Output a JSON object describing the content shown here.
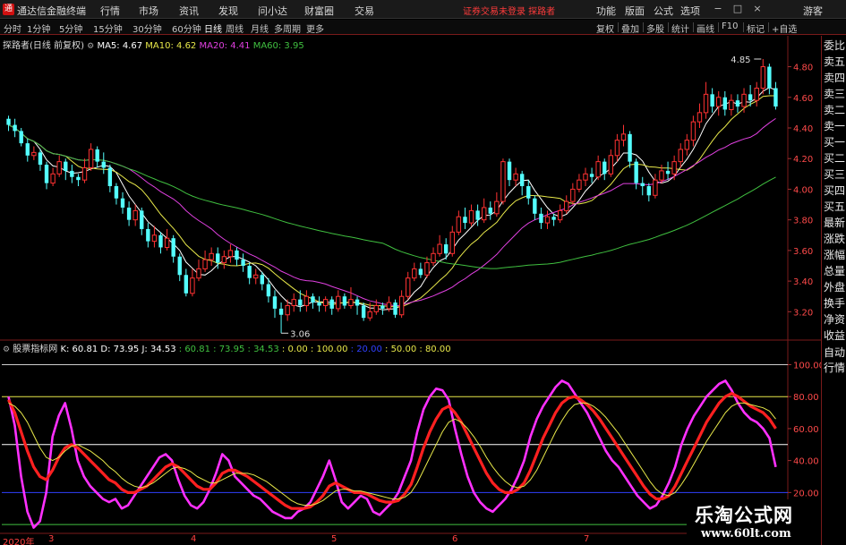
{
  "app": {
    "title": "通达信金融终端",
    "menu": [
      "行情",
      "市场",
      "资讯",
      "发现",
      "问小达",
      "财富圈",
      "交易"
    ],
    "login_status": "证券交易未登录  探路者",
    "right_menu": [
      "功能",
      "版面",
      "公式",
      "选项"
    ],
    "guest_label": "游客",
    "window_controls": {
      "min": "−",
      "max": "□",
      "close": "×"
    }
  },
  "toolbar": {
    "periods": [
      "分时",
      "1分钟",
      "5分钟",
      "15分钟",
      "30分钟",
      "60分钟",
      "日线",
      "周线",
      "月线",
      "多周期",
      "更多"
    ],
    "active_period": "日线",
    "tools": [
      "复权",
      "叠加",
      "多股",
      "统计",
      "画线",
      "F10",
      "标记",
      "+自选"
    ]
  },
  "main_info": {
    "stock": "探路者(日线 前复权)",
    "ma5": "MA5: 4.67",
    "ma10": "MA10: 4.62",
    "ma20": "MA20: 4.41",
    "ma60": "MA60: 3.95",
    "colors": {
      "stock": "#dcdcdc",
      "ma5": "#ffffff",
      "ma10": "#e8e84a",
      "ma20": "#e040e0",
      "ma60": "#40c040"
    }
  },
  "kdj_info": {
    "name": "股票指标网",
    "k": "K: 60.81",
    "d": "D: 73.95",
    "j": "J: 34.53",
    "extra": [
      ": 60.81",
      ": 73.95",
      ": 34.53",
      ": 0.00",
      ": 100.00",
      ": 20.00",
      ": 50.00",
      ": 80.00"
    ]
  },
  "sidebar": {
    "items": [
      "委比",
      "卖五",
      "卖四",
      "卖三",
      "卖二",
      "卖一",
      "买一",
      "买二",
      "买三",
      "买四",
      "买五",
      "最新",
      "涨跌",
      "涨幅",
      "总量",
      "外盘",
      "换手",
      "净资",
      "收益"
    ],
    "lower": [
      "自动",
      "行情"
    ]
  },
  "watermark": {
    "title": "乐淘公式网",
    "url": "www.60lt.com"
  },
  "bottom_axis": {
    "year_label": "2020年",
    "months": [
      "3",
      "4",
      "5",
      "6",
      "7"
    ]
  },
  "chart_data": [
    {
      "type": "candlestick",
      "y_ticks": [
        "4.80",
        "4.60",
        "4.40",
        "4.20",
        "4.00",
        "3.80",
        "3.60",
        "3.40",
        "3.20"
      ],
      "y_values": [
        4.8,
        4.6,
        4.4,
        4.2,
        4.0,
        3.8,
        3.6,
        3.4,
        3.2
      ],
      "ylim": [
        3.05,
        4.92
      ],
      "high_label": "4.85",
      "high_value": 4.85,
      "low_label": "3.06",
      "low_value": 3.06,
      "colors": {
        "up": "#ff3232",
        "down": "#54ffff",
        "ma5": "#ffffff",
        "ma10": "#e8e84a",
        "ma20": "#e040e0",
        "ma60": "#40c040"
      },
      "candles": [
        [
          4.46,
          4.42,
          4.48,
          4.38
        ],
        [
          4.42,
          4.38,
          4.46,
          4.34
        ],
        [
          4.38,
          4.3,
          4.4,
          4.28
        ],
        [
          4.3,
          4.22,
          4.33,
          4.18
        ],
        [
          4.22,
          4.24,
          4.28,
          4.19
        ],
        [
          4.24,
          4.16,
          4.26,
          4.12
        ],
        [
          4.16,
          4.04,
          4.18,
          4.0
        ],
        [
          4.04,
          4.1,
          4.14,
          4.02
        ],
        [
          4.1,
          4.18,
          4.22,
          4.08
        ],
        [
          4.18,
          4.12,
          4.2,
          4.06
        ],
        [
          4.12,
          4.08,
          4.16,
          4.04
        ],
        [
          4.08,
          4.06,
          4.1,
          4.02
        ],
        [
          4.06,
          4.14,
          4.2,
          4.04
        ],
        [
          4.14,
          4.26,
          4.3,
          4.12
        ],
        [
          4.26,
          4.18,
          4.28,
          4.14
        ],
        [
          4.18,
          4.14,
          4.24,
          4.1
        ],
        [
          4.14,
          4.02,
          4.16,
          3.98
        ],
        [
          4.02,
          3.94,
          4.04,
          3.9
        ],
        [
          3.94,
          3.88,
          3.98,
          3.84
        ],
        [
          3.88,
          3.8,
          3.92,
          3.76
        ],
        [
          3.8,
          3.86,
          3.9,
          3.76
        ],
        [
          3.86,
          3.74,
          3.88,
          3.7
        ],
        [
          3.74,
          3.66,
          3.78,
          3.62
        ],
        [
          3.66,
          3.7,
          3.76,
          3.62
        ],
        [
          3.7,
          3.62,
          3.72,
          3.58
        ],
        [
          3.62,
          3.68,
          3.74,
          3.6
        ],
        [
          3.68,
          3.56,
          3.7,
          3.52
        ],
        [
          3.56,
          3.44,
          3.58,
          3.4
        ],
        [
          3.44,
          3.32,
          3.48,
          3.3
        ],
        [
          3.32,
          3.42,
          3.48,
          3.3
        ],
        [
          3.42,
          3.48,
          3.54,
          3.4
        ],
        [
          3.48,
          3.54,
          3.6,
          3.46
        ],
        [
          3.54,
          3.58,
          3.62,
          3.5
        ],
        [
          3.58,
          3.52,
          3.62,
          3.48
        ],
        [
          3.52,
          3.56,
          3.6,
          3.48
        ],
        [
          3.56,
          3.6,
          3.64,
          3.52
        ],
        [
          3.6,
          3.54,
          3.62,
          3.5
        ],
        [
          3.54,
          3.5,
          3.58,
          3.46
        ],
        [
          3.5,
          3.42,
          3.52,
          3.38
        ],
        [
          3.42,
          3.44,
          3.48,
          3.38
        ],
        [
          3.44,
          3.38,
          3.46,
          3.34
        ],
        [
          3.38,
          3.3,
          3.42,
          3.26
        ],
        [
          3.3,
          3.22,
          3.34,
          3.16
        ],
        [
          3.22,
          3.18,
          3.26,
          3.06
        ],
        [
          3.18,
          3.24,
          3.28,
          3.14
        ],
        [
          3.24,
          3.28,
          3.32,
          3.2
        ],
        [
          3.28,
          3.24,
          3.34,
          3.2
        ],
        [
          3.24,
          3.3,
          3.34,
          3.2
        ],
        [
          3.3,
          3.26,
          3.32,
          3.22
        ],
        [
          3.26,
          3.24,
          3.3,
          3.2
        ],
        [
          3.24,
          3.28,
          3.3,
          3.2
        ],
        [
          3.28,
          3.22,
          3.3,
          3.18
        ],
        [
          3.22,
          3.3,
          3.34,
          3.2
        ],
        [
          3.3,
          3.24,
          3.32,
          3.22
        ],
        [
          3.24,
          3.28,
          3.36,
          3.22
        ],
        [
          3.28,
          3.24,
          3.3,
          3.18
        ],
        [
          3.24,
          3.16,
          3.26,
          3.14
        ],
        [
          3.16,
          3.2,
          3.26,
          3.14
        ],
        [
          3.2,
          3.24,
          3.28,
          3.18
        ],
        [
          3.24,
          3.22,
          3.26,
          3.18
        ],
        [
          3.22,
          3.26,
          3.3,
          3.2
        ],
        [
          3.26,
          3.18,
          3.28,
          3.16
        ],
        [
          3.18,
          3.3,
          3.34,
          3.16
        ],
        [
          3.3,
          3.42,
          3.46,
          3.28
        ],
        [
          3.42,
          3.48,
          3.52,
          3.4
        ],
        [
          3.48,
          3.44,
          3.52,
          3.42
        ],
        [
          3.44,
          3.52,
          3.56,
          3.42
        ],
        [
          3.52,
          3.58,
          3.62,
          3.5
        ],
        [
          3.58,
          3.64,
          3.7,
          3.56
        ],
        [
          3.64,
          3.58,
          3.68,
          3.54
        ],
        [
          3.58,
          3.72,
          3.76,
          3.56
        ],
        [
          3.72,
          3.82,
          3.86,
          3.7
        ],
        [
          3.82,
          3.78,
          3.88,
          3.74
        ],
        [
          3.78,
          3.86,
          3.9,
          3.76
        ],
        [
          3.86,
          3.8,
          3.9,
          3.76
        ],
        [
          3.8,
          3.88,
          3.94,
          3.78
        ],
        [
          3.88,
          3.84,
          3.92,
          3.8
        ],
        [
          3.84,
          3.92,
          3.98,
          3.82
        ],
        [
          3.92,
          4.18,
          4.2,
          3.9
        ],
        [
          4.18,
          4.06,
          4.2,
          4.02
        ],
        [
          4.06,
          4.1,
          4.14,
          4.02
        ],
        [
          4.1,
          4.02,
          4.12,
          3.96
        ],
        [
          4.02,
          3.94,
          4.06,
          3.9
        ],
        [
          3.94,
          3.84,
          3.96,
          3.8
        ],
        [
          3.84,
          3.78,
          3.88,
          3.74
        ],
        [
          3.78,
          3.82,
          3.86,
          3.74
        ],
        [
          3.82,
          3.8,
          3.84,
          3.76
        ],
        [
          3.8,
          3.86,
          3.9,
          3.78
        ],
        [
          3.86,
          3.92,
          3.96,
          3.84
        ],
        [
          3.92,
          4.0,
          4.04,
          3.9
        ],
        [
          4.0,
          4.06,
          4.1,
          3.98
        ],
        [
          4.06,
          4.1,
          4.14,
          4.02
        ],
        [
          4.1,
          4.08,
          4.14,
          4.04
        ],
        [
          4.08,
          4.18,
          4.22,
          4.06
        ],
        [
          4.18,
          4.1,
          4.2,
          4.06
        ],
        [
          4.1,
          4.22,
          4.26,
          4.08
        ],
        [
          4.22,
          4.32,
          4.36,
          4.18
        ],
        [
          4.32,
          4.36,
          4.42,
          4.28
        ],
        [
          4.36,
          4.18,
          4.38,
          4.14
        ],
        [
          4.18,
          4.04,
          4.2,
          4.0
        ],
        [
          4.04,
          4.02,
          4.08,
          3.96
        ],
        [
          4.02,
          3.96,
          4.04,
          3.92
        ],
        [
          3.96,
          4.06,
          4.1,
          3.94
        ],
        [
          4.06,
          4.12,
          4.16,
          4.04
        ],
        [
          4.12,
          4.1,
          4.18,
          4.06
        ],
        [
          4.1,
          4.18,
          4.22,
          4.06
        ],
        [
          4.18,
          4.26,
          4.3,
          4.14
        ],
        [
          4.26,
          4.32,
          4.36,
          4.22
        ],
        [
          4.32,
          4.44,
          4.48,
          4.28
        ],
        [
          4.44,
          4.5,
          4.56,
          4.4
        ],
        [
          4.5,
          4.62,
          4.7,
          4.46
        ],
        [
          4.62,
          4.54,
          4.66,
          4.5
        ],
        [
          4.54,
          4.6,
          4.64,
          4.48
        ],
        [
          4.6,
          4.52,
          4.64,
          4.48
        ],
        [
          4.52,
          4.58,
          4.62,
          4.48
        ],
        [
          4.58,
          4.54,
          4.62,
          4.5
        ],
        [
          4.54,
          4.62,
          4.66,
          4.5
        ],
        [
          4.62,
          4.58,
          4.68,
          4.54
        ],
        [
          4.58,
          4.66,
          4.7,
          4.54
        ],
        [
          4.66,
          4.8,
          4.85,
          4.62
        ],
        [
          4.8,
          4.66,
          4.82,
          4.62
        ],
        [
          4.66,
          4.54,
          4.7,
          4.52
        ]
      ]
    },
    {
      "type": "line",
      "y_ticks": [
        "100.00",
        "80.00",
        "60.00",
        "40.00",
        "20.00"
      ],
      "y_values": [
        100,
        80,
        60,
        40,
        20
      ],
      "ylim": [
        -5,
        107
      ],
      "reference_lines": [
        0,
        20,
        50,
        80,
        100
      ],
      "reference_colors": [
        "#40c040",
        "#3040ff",
        "#ffffff",
        "#e8e84a",
        "#cccccc"
      ],
      "series": [
        {
          "color": "#ff30ff",
          "values": [
            80,
            62,
            30,
            8,
            -2,
            2,
            20,
            55,
            68,
            76,
            60,
            40,
            30,
            24,
            20,
            16,
            14,
            16,
            10,
            12,
            18,
            24,
            30,
            36,
            42,
            44,
            40,
            28,
            18,
            12,
            10,
            14,
            22,
            32,
            44,
            40,
            30,
            26,
            22,
            18,
            16,
            12,
            8,
            6,
            4,
            4,
            8,
            10,
            14,
            22,
            30,
            40,
            28,
            14,
            10,
            14,
            18,
            16,
            8,
            6,
            10,
            14,
            20,
            30,
            40,
            58,
            72,
            80,
            85,
            84,
            78,
            60,
            44,
            30,
            20,
            14,
            10,
            8,
            12,
            16,
            22,
            30,
            40,
            55,
            66,
            74,
            80,
            86,
            90,
            88,
            82,
            76,
            70,
            62,
            54,
            46,
            40,
            36,
            30,
            24,
            18,
            14,
            10,
            12,
            18,
            26,
            36,
            50,
            60,
            68,
            74,
            80,
            84,
            88,
            90,
            84,
            76,
            70,
            66,
            64,
            60,
            54,
            36
          ]
        },
        {
          "color": "#ff2020",
          "values": [
            78,
            70,
            58,
            46,
            36,
            30,
            28,
            34,
            42,
            48,
            50,
            48,
            44,
            40,
            36,
            32,
            28,
            26,
            22,
            20,
            20,
            22,
            24,
            28,
            32,
            36,
            38,
            36,
            32,
            28,
            24,
            22,
            22,
            26,
            32,
            34,
            34,
            32,
            30,
            27,
            24,
            21,
            18,
            15,
            12,
            10,
            10,
            10,
            11,
            14,
            18,
            24,
            26,
            24,
            22,
            20,
            20,
            19,
            17,
            15,
            14,
            14,
            15,
            19,
            25,
            36,
            48,
            58,
            66,
            72,
            74,
            70,
            64,
            56,
            48,
            40,
            32,
            26,
            22,
            20,
            20,
            22,
            26,
            34,
            44,
            54,
            62,
            70,
            76,
            79,
            80,
            78,
            75,
            71,
            66,
            60,
            54,
            48,
            42,
            36,
            30,
            24,
            19,
            16,
            16,
            18,
            24,
            32,
            40,
            48,
            56,
            64,
            70,
            76,
            80,
            82,
            80,
            77,
            74,
            72,
            70,
            66,
            60
          ]
        },
        {
          "color": "#e8e84a",
          "values": [
            76,
            74,
            70,
            64,
            56,
            48,
            42,
            40,
            42,
            46,
            49,
            50,
            48,
            46,
            43,
            40,
            36,
            33,
            29,
            26,
            24,
            23,
            24,
            26,
            29,
            32,
            35,
            36,
            35,
            33,
            30,
            28,
            26,
            26,
            28,
            30,
            32,
            32,
            32,
            31,
            29,
            27,
            24,
            21,
            18,
            15,
            13,
            12,
            12,
            13,
            15,
            18,
            21,
            22,
            22,
            21,
            21,
            20,
            19,
            18,
            17,
            16,
            16,
            17,
            20,
            26,
            34,
            42,
            50,
            58,
            64,
            66,
            64,
            60,
            55,
            49,
            42,
            36,
            31,
            27,
            24,
            23,
            24,
            28,
            34,
            42,
            50,
            58,
            65,
            71,
            75,
            76,
            76,
            74,
            71,
            67,
            62,
            57,
            51,
            45,
            39,
            33,
            27,
            22,
            19,
            18,
            20,
            25,
            31,
            38,
            45,
            52,
            58,
            64,
            70,
            74,
            76,
            76,
            75,
            74,
            73,
            71,
            66
          ]
        }
      ]
    }
  ]
}
